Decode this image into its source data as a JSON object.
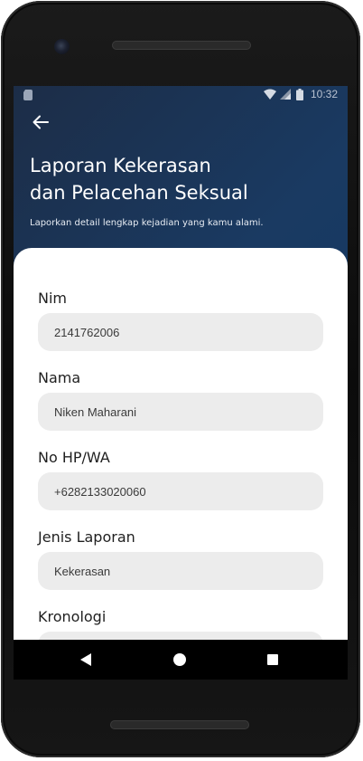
{
  "status_bar": {
    "time": "10:32",
    "icons": [
      "sim-card-icon",
      "wifi-icon",
      "signal-icon",
      "battery-icon"
    ]
  },
  "header": {
    "back_icon": "arrow-left-icon",
    "title_line1": "Laporan Kekerasan",
    "title_line2": "dan Pelacehan Seksual",
    "subtitle": "Laporkan detail lengkap kejadian yang kamu alami."
  },
  "form": {
    "fields": [
      {
        "label": "Nim",
        "value": "2141762006"
      },
      {
        "label": "Nama",
        "value": "Niken Maharani"
      },
      {
        "label": "No HP/WA",
        "value": "+6282133020060"
      },
      {
        "label": "Jenis Laporan",
        "value": "Kekerasan"
      },
      {
        "label": "Kronologi",
        "value": ""
      }
    ]
  },
  "nav_bar": {
    "icons": [
      "nav-back-icon",
      "nav-home-icon",
      "nav-recents-icon"
    ]
  },
  "colors": {
    "header_gradient_start": "#1c2d47",
    "header_gradient_end": "#0d3561",
    "card_background": "#ffffff",
    "input_background": "#ececec",
    "label_text": "#1f1f1f",
    "title_text": "#ffffff"
  }
}
